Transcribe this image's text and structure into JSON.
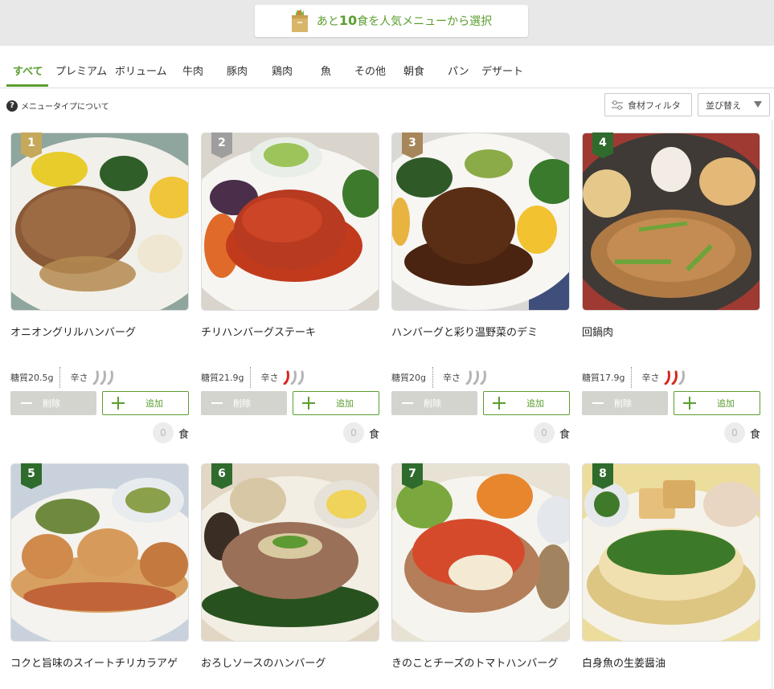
{
  "banner": {
    "prefix": "あと",
    "number": "10",
    "suffix": "食を人気メニューから選択"
  },
  "tabs": [
    {
      "label": "すべて",
      "active": true
    },
    {
      "label": "プレミアム"
    },
    {
      "label": "ボリューム"
    },
    {
      "label": "牛肉"
    },
    {
      "label": "豚肉"
    },
    {
      "label": "鶏肉"
    },
    {
      "label": "魚"
    },
    {
      "label": "その他"
    },
    {
      "label": "朝食"
    },
    {
      "label": "パン"
    },
    {
      "label": "デザート"
    }
  ],
  "toolbar": {
    "help_icon": "?",
    "help_text": "メニュータイプについて",
    "filter_label": "食材フィルタ",
    "sort_label": "並び替え"
  },
  "colors": {
    "accent": "#5a9e2f",
    "spice_red": "#d42a1f",
    "spice_gray": "#b5b5b5"
  },
  "buttons": {
    "remove": "削除",
    "add": "追加",
    "unit": "食"
  },
  "menus": [
    {
      "rank": "1",
      "name": "オニオングリルハンバーグ",
      "sugar": "糖質20.5g",
      "spice_label": "辛さ",
      "spice_level": 0,
      "count": "0"
    },
    {
      "rank": "2",
      "name": "チリハンバーグステーキ",
      "sugar": "糖質21.9g",
      "spice_label": "辛さ",
      "spice_level": 1,
      "count": "0"
    },
    {
      "rank": "3",
      "name": "ハンバーグと彩り温野菜のデミ",
      "sugar": "糖質20g",
      "spice_label": "辛さ",
      "spice_level": 0,
      "count": "0"
    },
    {
      "rank": "4",
      "name": "回鍋肉",
      "sugar": "糖質17.9g",
      "spice_label": "辛さ",
      "spice_level": 2,
      "count": "0"
    },
    {
      "rank": "5",
      "name": "コクと旨味のスイートチリカラアゲ"
    },
    {
      "rank": "6",
      "name": "おろしソースのハンバーグ"
    },
    {
      "rank": "7",
      "name": "きのことチーズのトマトハンバーグ"
    },
    {
      "rank": "8",
      "name": "白身魚の生姜醤油"
    }
  ]
}
